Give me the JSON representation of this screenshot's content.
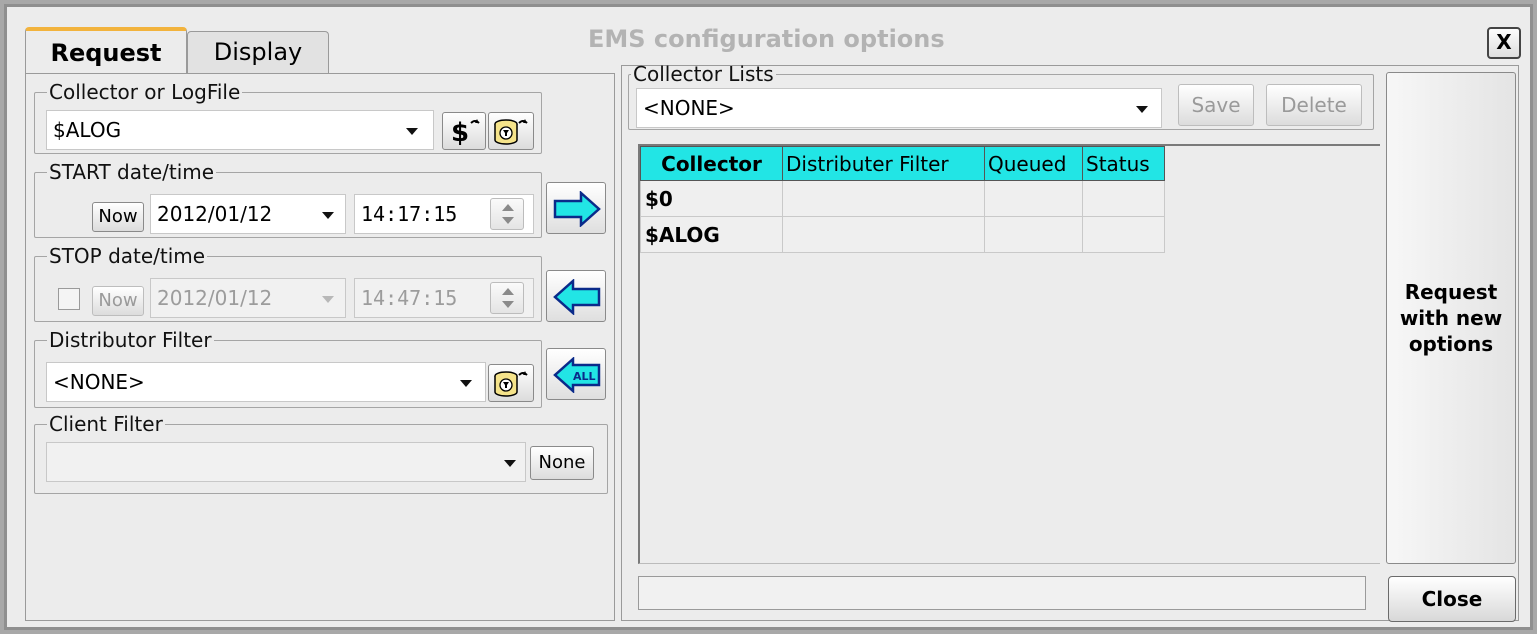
{
  "window": {
    "title": "EMS configuration options",
    "close_x": "X"
  },
  "tabs": [
    {
      "label": "Request"
    },
    {
      "label": "Display"
    }
  ],
  "collector": {
    "legend": "Collector or LogFile",
    "value": "$ALOG"
  },
  "start": {
    "legend": "START date/time",
    "now_label": "Now",
    "date": "2012/01/12",
    "time": "14:17:15"
  },
  "stop": {
    "legend": "STOP date/time",
    "now_label": "Now",
    "date": "2012/01/12",
    "time": "14:47:15",
    "enabled": false
  },
  "distributor": {
    "legend": "Distributor Filter",
    "value": "<NONE>"
  },
  "client": {
    "legend": "Client Filter",
    "value": "",
    "none_label": "None"
  },
  "collector_lists": {
    "legend": "Collector Lists",
    "value": "<NONE>",
    "save_label": "Save",
    "delete_label": "Delete",
    "columns": [
      "Collector",
      "Distributer Filter",
      "Queued",
      "Status"
    ],
    "rows": [
      {
        "collector": "$0",
        "filter": "",
        "queued": "",
        "status": ""
      },
      {
        "collector": "$ALOG",
        "filter": "",
        "queued": "",
        "status": ""
      }
    ]
  },
  "actions": {
    "request_label": "Request with new options",
    "close_label": "Close"
  },
  "colors": {
    "header_cyan": "#22e5e5",
    "arrow_cyan": "#22e5e5",
    "tab_accent": "#f2b33d"
  }
}
